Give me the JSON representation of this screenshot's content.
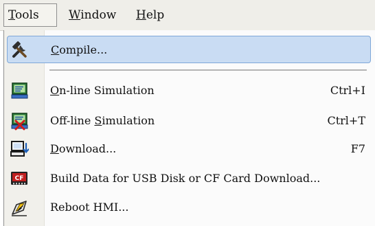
{
  "menubar": {
    "tools": {
      "first": "T",
      "rest": "ools"
    },
    "window": {
      "first": "W",
      "rest": "indow"
    },
    "help": {
      "first": "H",
      "rest": "elp"
    }
  },
  "tools_menu": {
    "items": [
      {
        "first": "C",
        "rest": "ompile...",
        "shortcut": "",
        "icon": "hammer-wrench-icon",
        "highlighted": true
      },
      {
        "first": "O",
        "rest": "n-line Simulation",
        "shortcut": "Ctrl+I",
        "icon": "online-simulation-icon"
      },
      {
        "before": "Off-line ",
        "underlined": "S",
        "after": "imulation",
        "shortcut": "Ctrl+T",
        "icon": "offline-simulation-icon"
      },
      {
        "first": "D",
        "rest": "ownload...",
        "shortcut": "F7",
        "icon": "download-icon"
      },
      {
        "label": "Build Data for USB Disk or CF Card Download...",
        "shortcut": "",
        "icon": "cf-card-icon"
      },
      {
        "label": "Reboot HMI...",
        "shortcut": "",
        "icon": "reboot-hmi-icon"
      }
    ]
  }
}
